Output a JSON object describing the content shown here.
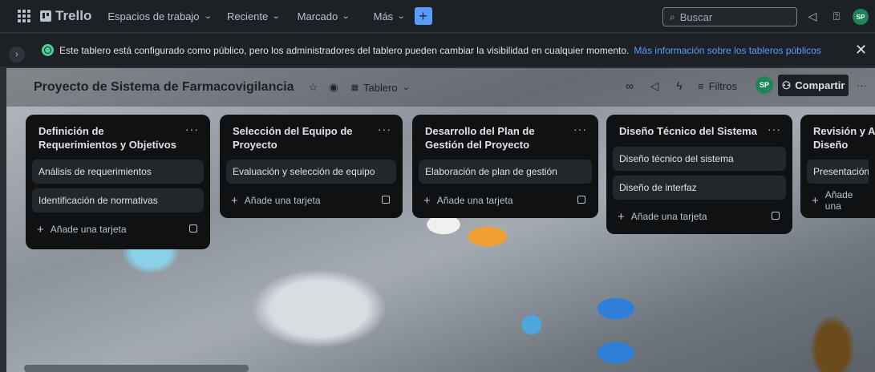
{
  "topbar": {
    "app_name": "Trello",
    "nav": [
      "Espacios de trabajo",
      "Reciente",
      "Marcado",
      "Más"
    ],
    "create_label": "+",
    "search_placeholder": "Buscar",
    "user_initials": "SP"
  },
  "banner": {
    "message": "Este tablero está configurado como público, pero los administradores del tablero pueden cambiar la visibilidad en cualquier momento.",
    "link": "Más información sobre los tableros públicos",
    "close": "✕"
  },
  "board": {
    "title": "Proyecto de Sistema de Farmacovigilancia",
    "view_label": "Tablero",
    "filters_label": "Filtros",
    "member_initials": "SP",
    "share_label": "Compartir",
    "more": "···"
  },
  "lists": [
    {
      "title": "Definición de Requerimientos y Objetivos",
      "cards": [
        "Análisis de requerimientos",
        "Identificación de normativas"
      ],
      "add_label": "Añade una tarjeta"
    },
    {
      "title": "Selección del Equipo de Proyecto",
      "cards": [
        "Evaluación y selección de equipo"
      ],
      "add_label": "Añade una tarjeta"
    },
    {
      "title": "Desarrollo del Plan de Gestión del Proyecto",
      "cards": [
        "Elaboración de plan de gestión"
      ],
      "add_label": "Añade una tarjeta"
    },
    {
      "title": "Diseño Técnico del Sistema",
      "cards": [
        "Diseño técnico del sistema",
        "Diseño de interfaz"
      ],
      "add_label": "Añade una tarjeta"
    },
    {
      "title": "Revisión y Apr Diseño",
      "cards": [
        "Presentación d"
      ],
      "add_label": "Añade una"
    }
  ],
  "list_menu": "···"
}
